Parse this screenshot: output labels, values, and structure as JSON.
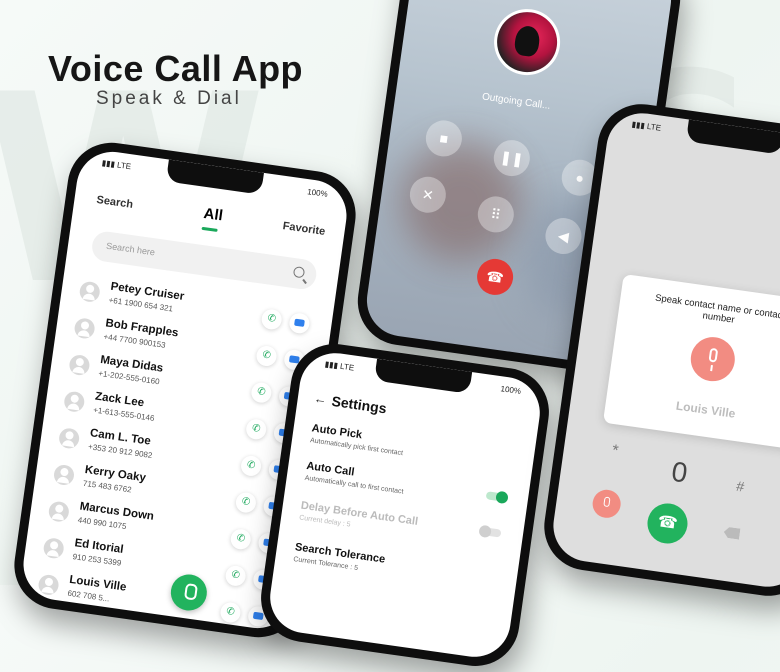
{
  "hero": {
    "title": "Voice Call App",
    "subtitle": "Speak & Dial"
  },
  "contacts_screen": {
    "status": {
      "signal": "LTE",
      "battery": "100%"
    },
    "tabs": [
      "Search",
      "All",
      "Favorite"
    ],
    "active_tab": "All",
    "search_placeholder": "Search here",
    "contacts": [
      {
        "name": "Petey Cruiser",
        "number": "+61 1900 654 321"
      },
      {
        "name": "Bob Frapples",
        "number": "+44 7700 900153"
      },
      {
        "name": "Maya Didas",
        "number": "+1-202-555-0160"
      },
      {
        "name": "Zack Lee",
        "number": "+1-613-555-0146"
      },
      {
        "name": "Cam L. Toe",
        "number": "+353 20 912 9082"
      },
      {
        "name": "Kerry Oaky",
        "number": "715 483 6762"
      },
      {
        "name": "Marcus Down",
        "number": "440 990 1075"
      },
      {
        "name": "Ed Itorial",
        "number": "910 253 5399"
      },
      {
        "name": "Louis Ville",
        "number": "602 708 5..."
      }
    ]
  },
  "outgoing_screen": {
    "status_text": "Outgoing Call..."
  },
  "settings_screen": {
    "status": {
      "signal": "LTE",
      "battery": "100%"
    },
    "title": "Settings",
    "items": [
      {
        "title": "Auto Pick",
        "desc": "Automatically pick first contact"
      },
      {
        "title": "Auto Call",
        "desc": "Automatically call to first contact"
      },
      {
        "title": "Delay Before Auto Call",
        "desc": "Current delay : 5"
      },
      {
        "title": "Search Tolerance",
        "desc": "Current Tolerance : 5"
      }
    ]
  },
  "dial_screen": {
    "status": {
      "signal": "LTE"
    },
    "prompt": "Speak contact name or contact number",
    "recognized_name": "Louis Ville",
    "dial_value": "0",
    "star": "*",
    "hash": "#"
  }
}
